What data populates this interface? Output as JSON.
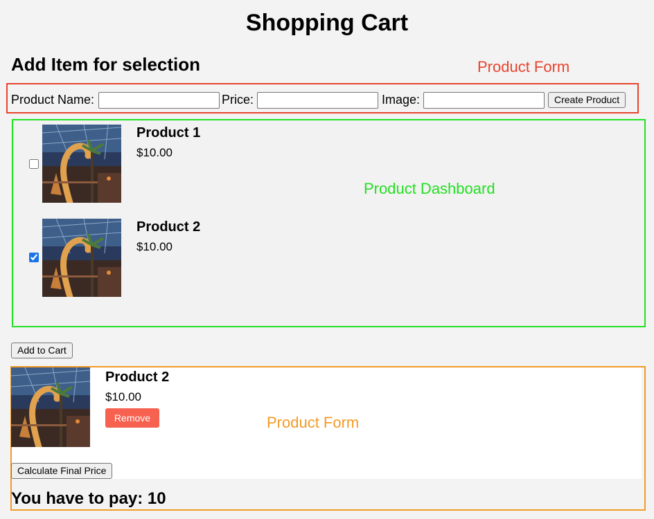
{
  "page": {
    "title": "Shopping Cart"
  },
  "product_form": {
    "heading": "Add Item for selection",
    "annotation": "Product Form",
    "name_label": "Product Name:",
    "name_value": "",
    "price_label": "Price:",
    "price_value": "",
    "image_label": "Image:",
    "image_value": "",
    "create_button": "Create Product"
  },
  "dashboard": {
    "annotation": "Product Dashboard",
    "products": [
      {
        "name": "Product 1",
        "price": "$10.00",
        "checked": false
      },
      {
        "name": "Product 2",
        "price": "$10.00",
        "checked": true
      }
    ],
    "add_to_cart_button": "Add to Cart"
  },
  "cart": {
    "annotation": "Product Form",
    "items": [
      {
        "name": "Product 2",
        "price": "$10.00",
        "remove_label": "Remove"
      }
    ],
    "calculate_button": "Calculate Final Price",
    "total_text": "You have to pay: 10"
  },
  "colors": {
    "form_border": "#e8432d",
    "dashboard_border": "#22e022",
    "cart_border": "#f39a26",
    "remove_button": "#f7614f"
  }
}
